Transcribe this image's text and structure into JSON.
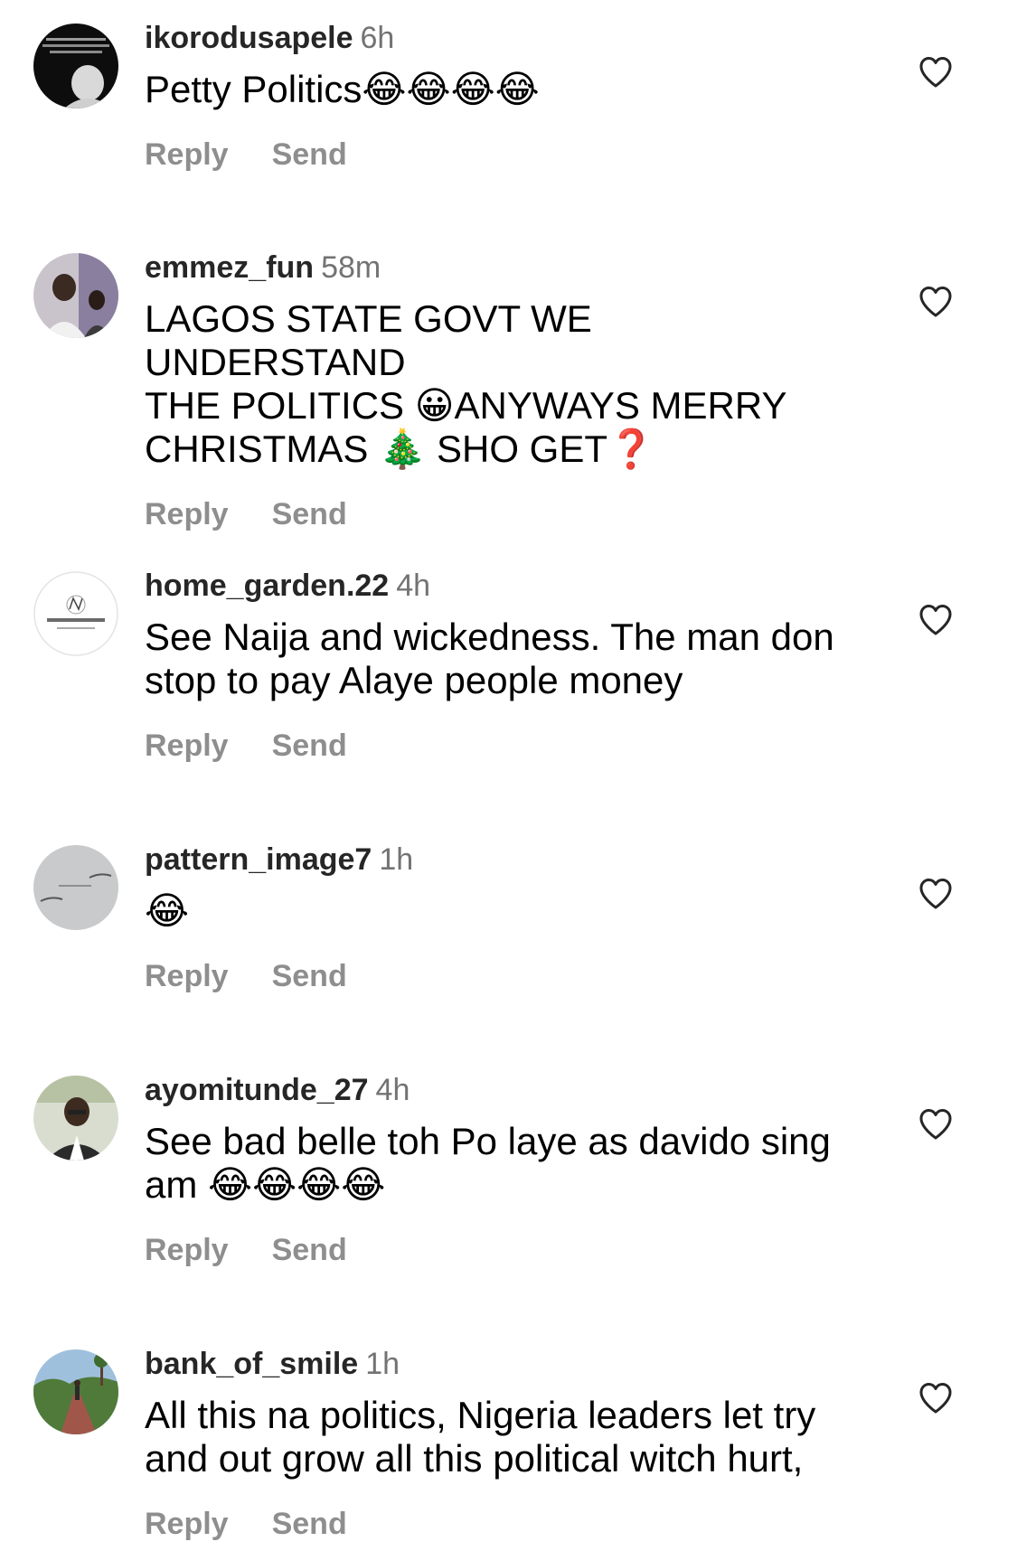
{
  "action_labels": {
    "reply": "Reply",
    "send": "Send"
  },
  "icons": {
    "like": "heart-outline-icon"
  },
  "colors": {
    "username": "#262626",
    "timestamp": "#737373",
    "action": "#8e8e8e",
    "text": "#000000"
  },
  "comments": [
    {
      "username": "ikorodusapele",
      "time": "6h",
      "text": "Petty Politics😂😂😂😂"
    },
    {
      "username": "emmez_fun",
      "time": "58m",
      "text": "LAGOS STATE GOVT WE UNDERSTAND\nTHE POLITICS 😀ANYWAYS MERRY\nCHRISTMAS 🎄 SHO GET❓"
    },
    {
      "username": "home_garden.22",
      "time": "4h",
      "text": "See Naija and wickedness. The man don\nstop to pay Alaye people money"
    },
    {
      "username": "pattern_image7",
      "time": "1h",
      "text": "😂"
    },
    {
      "username": "ayomitunde_27",
      "time": "4h",
      "text": "See bad belle toh Po laye as davido sing\nam 😂😂😂😂"
    },
    {
      "username": "bank_of_smile",
      "time": "1h",
      "text": "All this na politics, Nigeria leaders let try\nand out grow all this political witch hurt,"
    }
  ]
}
